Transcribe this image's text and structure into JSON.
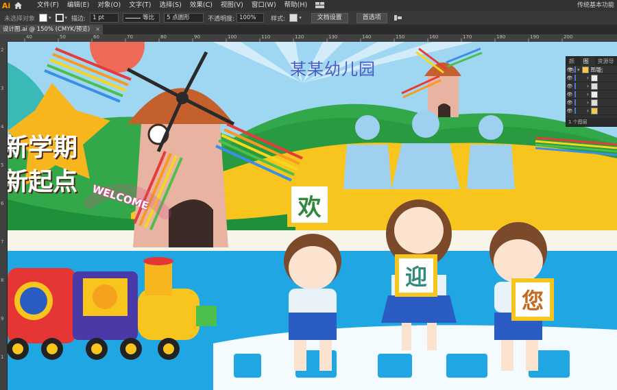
{
  "app": {
    "logo": "Ai",
    "workspace": "传统基本功能"
  },
  "menu": [
    "文件(F)",
    "编辑(E)",
    "对象(O)",
    "文字(T)",
    "选择(S)",
    "效果(C)",
    "视图(V)",
    "窗口(W)",
    "帮助(H)"
  ],
  "control": {
    "selection_state": "未选择对象",
    "stroke_label": "描边:",
    "stroke_width": "1 pt",
    "profile": "等比",
    "brush": "5 点圆形",
    "opacity_label": "不透明度:",
    "opacity": "100%",
    "style_label": "样式:",
    "doc_setup": "文档设置",
    "prefs": "首选项"
  },
  "document": {
    "tab_title": "设计图.ai @ 150% (CMYK/预览)",
    "close": "×"
  },
  "ruler": {
    "top_ticks": [
      "40",
      "50",
      "60",
      "70",
      "80",
      "90",
      "100",
      "110",
      "120",
      "130",
      "140",
      "150",
      "160",
      "170",
      "180",
      "190",
      "200"
    ],
    "left_ticks": [
      "2",
      "3",
      "4",
      "5",
      "6",
      "7",
      "8",
      "9",
      "1"
    ]
  },
  "artwork": {
    "school_name": "某某幼儿园",
    "slogan_line1": "新学期",
    "slogan_line2": "新起点",
    "welcome": "WELCOME",
    "signs": [
      "欢",
      "迎",
      "您"
    ]
  },
  "layers_panel": {
    "tabs": [
      "颜色",
      "图层",
      "资源导出"
    ],
    "top_layer": "图层",
    "footer": "1 个图层"
  },
  "colors": {
    "accent": "#ff9a00",
    "sky": "#3aa7e0",
    "grass": "#33a84a",
    "yellow": "#f7c51e"
  }
}
